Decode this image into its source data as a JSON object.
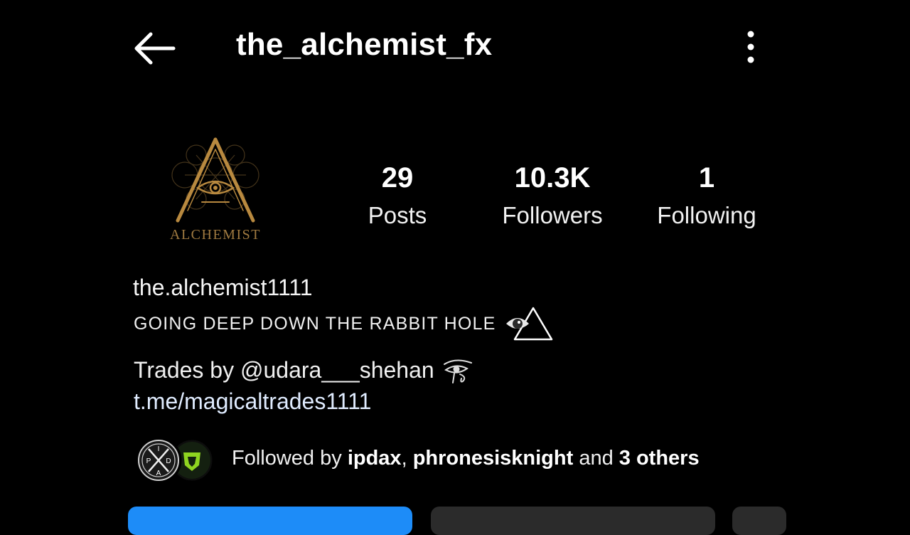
{
  "header": {
    "username": "the_alchemist_fx",
    "back_icon": "arrow-left-icon",
    "more_icon": "more-vertical-icon"
  },
  "avatar": {
    "logo_text": "ALCHEMIST"
  },
  "stats": [
    {
      "value": "29",
      "label": "Posts"
    },
    {
      "value": "10.3K",
      "label": "Followers"
    },
    {
      "value": "1",
      "label": "Following"
    }
  ],
  "bio": {
    "display_name": "the.alchemist1111",
    "tagline": "GOING DEEP DOWN THE RABBIT HOLE",
    "tagline_icon": "eye-pyramid-icon",
    "trades": "Trades by @udara___shehan",
    "trades_icon": "eye-of-horus-icon",
    "link": "t.me/magicaltrades1111"
  },
  "followed_by": {
    "prefix": "Followed by ",
    "user1": "ipdax",
    "separator": ", ",
    "user2": "phronesisknight",
    "middle": " and ",
    "others": "3 others",
    "avatar1_letters": {
      "top": "I",
      "left": "P",
      "right": "D",
      "bottom": "A"
    }
  },
  "colors": {
    "background": "#000000",
    "gold": "#b8893f",
    "follow_button": "#1d8cf8",
    "secondary_button": "#2b2b2b"
  }
}
